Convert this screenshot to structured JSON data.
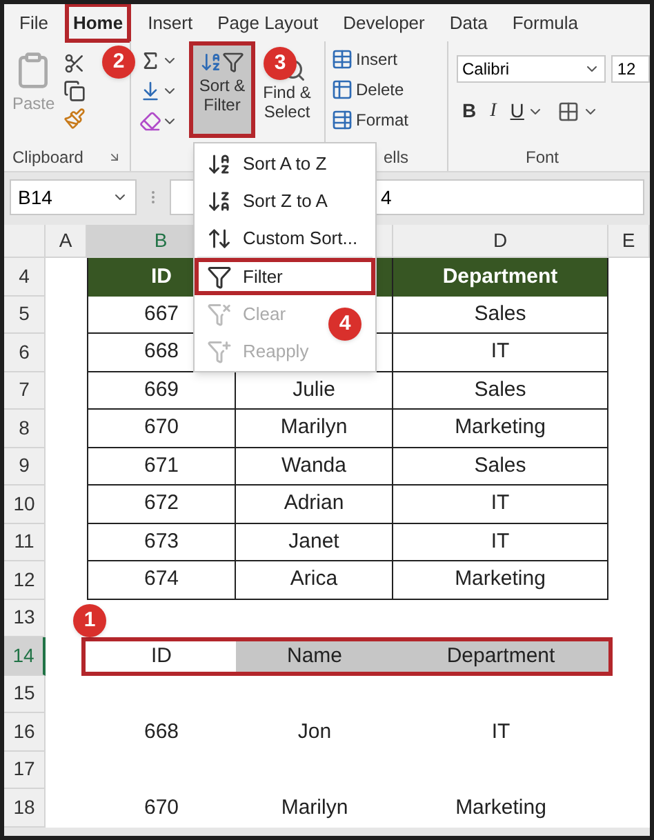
{
  "ribbon_tabs": [
    {
      "label": "File",
      "selected": false,
      "outlined": false
    },
    {
      "label": "Home",
      "selected": true,
      "outlined": true
    },
    {
      "label": "Insert",
      "selected": false,
      "outlined": false
    },
    {
      "label": "Page Layout",
      "selected": false,
      "outlined": false
    },
    {
      "label": "Developer",
      "selected": false,
      "outlined": false
    },
    {
      "label": "Data",
      "selected": false,
      "outlined": false
    },
    {
      "label": "Formula",
      "selected": false,
      "outlined": false
    }
  ],
  "clipboard": {
    "paste": "Paste",
    "group_label": "Clipboard"
  },
  "sort_filter": {
    "label": "Sort & Filter",
    "pressed": true,
    "outlined": true
  },
  "find_select": {
    "label": "Find & Select"
  },
  "cells": {
    "insert": "Insert",
    "delete": "Delete",
    "format": "Format",
    "group_label": "ells"
  },
  "font": {
    "name": "Calibri",
    "size": "12",
    "bold": "B",
    "italic": "I",
    "underline": "U",
    "group_label": "Font"
  },
  "name_box": "B14",
  "formula_value": "4",
  "columns": [
    {
      "label": "A",
      "selected": false
    },
    {
      "label": "B",
      "selected": true
    },
    {
      "selected": false
    },
    {
      "label": "D",
      "selected": false
    },
    {
      "label": "E",
      "selected": false
    }
  ],
  "rows": [
    {
      "number": "4",
      "kind": "header",
      "selected": false,
      "id": "ID",
      "department": "Department"
    },
    {
      "number": "5",
      "kind": "data",
      "selected": false,
      "id": "667",
      "department": "Sales"
    },
    {
      "number": "6",
      "kind": "data",
      "selected": false,
      "id": "668",
      "department": "IT"
    },
    {
      "number": "7",
      "kind": "data",
      "selected": false,
      "id": "669",
      "name": "Julie",
      "department": "Sales"
    },
    {
      "number": "8",
      "kind": "data",
      "selected": false,
      "id": "670",
      "name": "Marilyn",
      "department": "Marketing"
    },
    {
      "number": "9",
      "kind": "data",
      "selected": false,
      "id": "671",
      "name": "Wanda",
      "department": "Sales"
    },
    {
      "number": "10",
      "kind": "data",
      "selected": false,
      "id": "672",
      "name": "Adrian",
      "department": "IT"
    },
    {
      "number": "11",
      "kind": "data",
      "selected": false,
      "id": "673",
      "name": "Janet",
      "department": "IT"
    },
    {
      "number": "12",
      "kind": "data",
      "selected": false,
      "id": "674",
      "name": "Arica",
      "department": "Marketing"
    },
    {
      "number": "13",
      "kind": "blank",
      "selected": false
    },
    {
      "number": "14",
      "kind": "selection",
      "selected": true,
      "outlined": true,
      "id": "ID",
      "name": "Name",
      "department": "Department"
    },
    {
      "number": "15",
      "kind": "blank",
      "selected": false
    },
    {
      "number": "16",
      "kind": "plain",
      "selected": false,
      "id": "668",
      "name": "Jon",
      "department": "IT"
    },
    {
      "number": "17",
      "kind": "blank",
      "selected": false
    },
    {
      "number": "18",
      "kind": "plain",
      "selected": false,
      "id": "670",
      "name": "Marilyn",
      "department": "Marketing"
    }
  ],
  "menu": [
    {
      "kind": "sort_az",
      "label": "Sort A to Z",
      "disabled": false,
      "outlined": false
    },
    {
      "kind": "sort_za",
      "label": "Sort Z to A",
      "disabled": false,
      "outlined": false
    },
    {
      "kind": "custom",
      "label": "Custom Sort...",
      "disabled": false,
      "outlined": false
    },
    {
      "kind": "filter",
      "label": "Filter",
      "disabled": false,
      "outlined": true
    },
    {
      "kind": "clear",
      "label": "Clear",
      "disabled": true,
      "outlined": false
    },
    {
      "kind": "reapply",
      "label": "Reapply",
      "disabled": true,
      "outlined": false
    }
  ],
  "step_badges": [
    "1",
    "2",
    "3",
    "4"
  ]
}
